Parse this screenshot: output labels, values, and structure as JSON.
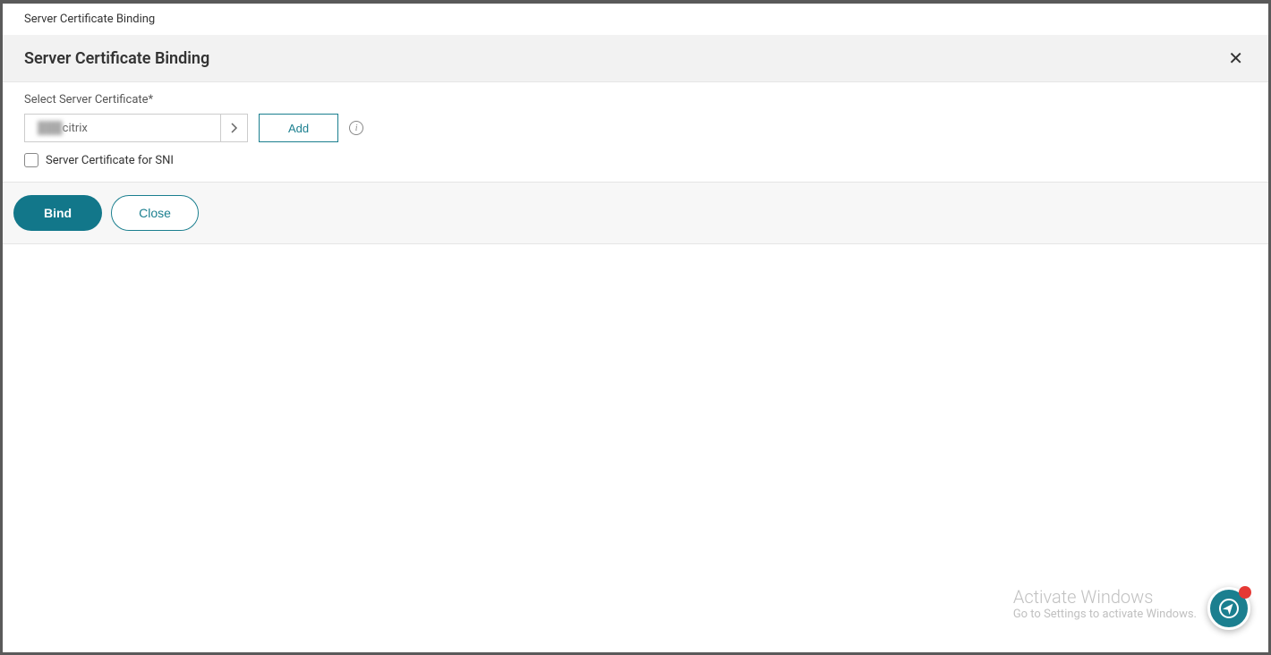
{
  "breadcrumb": "Server Certificate Binding",
  "header": {
    "title": "Server Certificate Binding"
  },
  "form": {
    "selectLabel": "Select Server Certificate*",
    "selectValue": "citrix",
    "addLabel": "Add",
    "sniCheckboxLabel": "Server Certificate for SNI"
  },
  "buttons": {
    "bind": "Bind",
    "close": "Close"
  },
  "watermark": {
    "title": "Activate Windows",
    "text": "Go to Settings to activate Windows."
  }
}
